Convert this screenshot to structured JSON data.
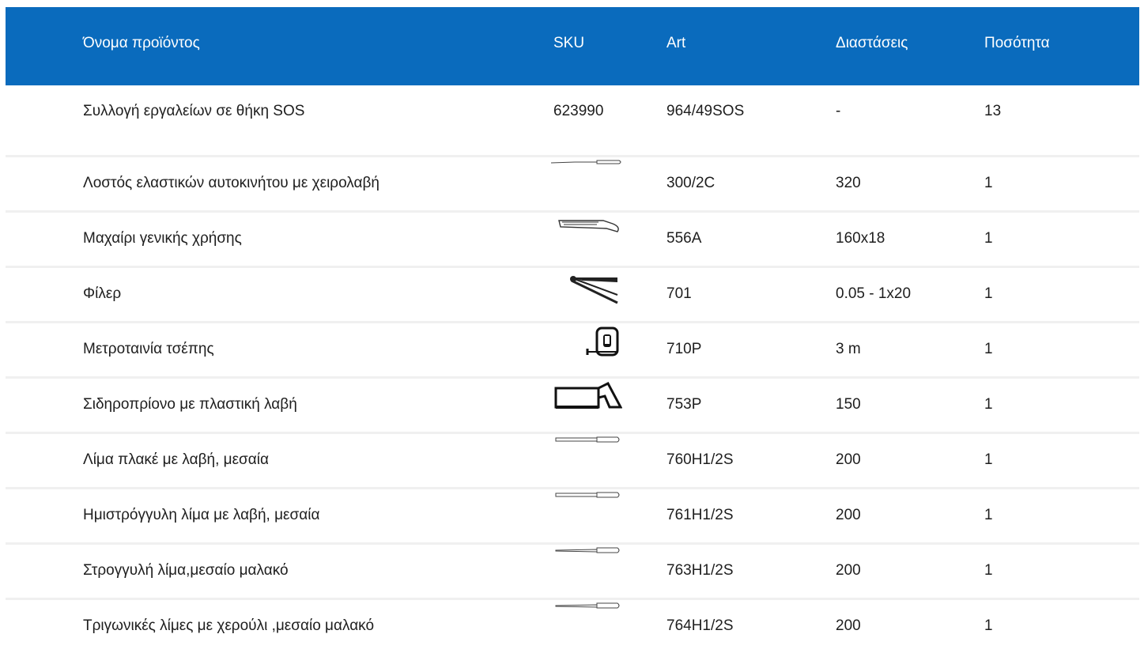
{
  "table": {
    "headers": {
      "name": "Όνομα προϊόντος",
      "sku": "SKU",
      "art": "Art",
      "dimensions": "Διαστάσεις",
      "quantity": "Ποσότητα"
    },
    "rows": [
      {
        "name": "Συλλογή εργαλείων σε θήκη SOS",
        "sku": "623990",
        "art": "964/49SOS",
        "dimensions": "-",
        "quantity": "13"
      },
      {
        "name": "Λοστός ελαστικών αυτοκινήτου με χειρολαβή",
        "icon": "tyre-lever-icon",
        "art": "300/2C",
        "dimensions": "320",
        "quantity": "1"
      },
      {
        "name": "Μαχαίρι γενικής χρήσης",
        "icon": "utility-knife-icon",
        "art": "556A",
        "dimensions": "160x18",
        "quantity": "1"
      },
      {
        "name": "Φίλερ",
        "icon": "feeler-gauge-icon",
        "art": "701",
        "dimensions": "0.05 - 1x20",
        "quantity": "1"
      },
      {
        "name": "Μετροταινία τσέπης",
        "icon": "tape-measure-icon",
        "art": "710P",
        "dimensions": "3 m",
        "quantity": "1"
      },
      {
        "name": "Σιδηροπρίονο με πλαστική λαβή",
        "icon": "hacksaw-icon",
        "art": "753P",
        "dimensions": "150",
        "quantity": "1"
      },
      {
        "name": "Λίμα πλακέ με λαβή, μεσαία",
        "icon": "flat-file-icon",
        "art": "760H1/2S",
        "dimensions": "200",
        "quantity": "1"
      },
      {
        "name": "Ημιστρόγγυλη λίμα με λαβή, μεσαία",
        "icon": "half-round-file-icon",
        "art": "761H1/2S",
        "dimensions": "200",
        "quantity": "1"
      },
      {
        "name": "Στρογγυλή λίμα,μεσαίο μαλακό",
        "icon": "round-file-icon",
        "art": "763H1/2S",
        "dimensions": "200",
        "quantity": "1"
      },
      {
        "name": "Τριγωνικές λίμες με χερούλι ,μεσαίο μαλακό",
        "icon": "triangular-file-icon",
        "art": "764H1/2S",
        "dimensions": "200",
        "quantity": "1"
      }
    ]
  },
  "colors": {
    "header_bg": "#0a6bbd",
    "header_text": "#ffffff",
    "row_divider": "#f0f0f0"
  }
}
